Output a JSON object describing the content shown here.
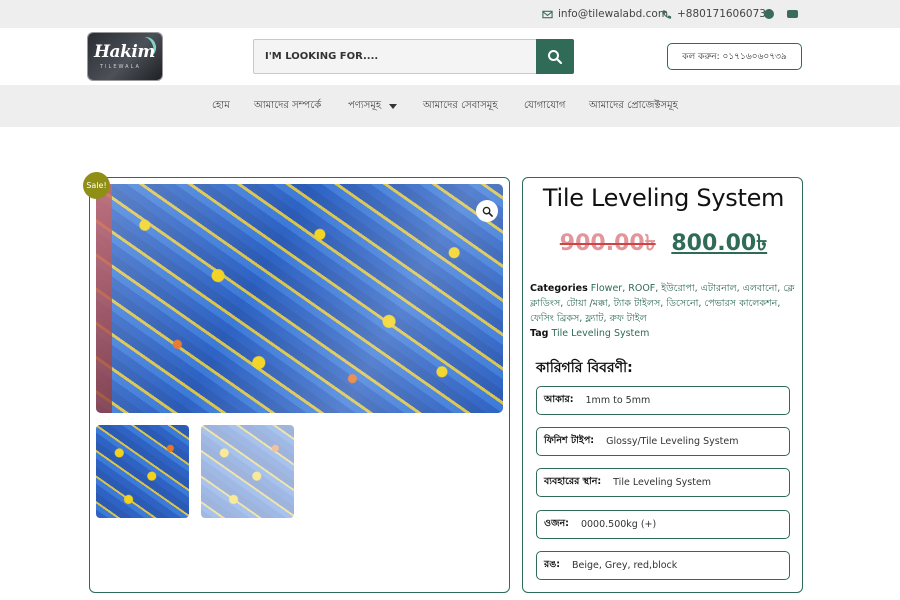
{
  "topbar": {
    "email": "info@tilewalabd.com",
    "phone": "+8801716060739"
  },
  "header": {
    "logo_text": "Hakim",
    "logo_sub": "TILEWALA",
    "search_placeholder": "I'M LOOKING FOR....",
    "call_button": "কল করুন: ০১৭১৬০৬০৭৩৯"
  },
  "nav": {
    "items": [
      "হোম",
      "আমাদের সম্পর্কে",
      "পণ্যসমূহ",
      "আমাদের সেবাসমূহ",
      "যোগাযোগ",
      "আমাদের প্রোজেক্টসমূহ"
    ]
  },
  "gallery": {
    "sale_badge": "Sale!"
  },
  "product": {
    "title": "Tile Leveling System",
    "old_price": "900.00৳",
    "new_price": "800.00৳",
    "categories_label": "Categories",
    "categories": "Flower, ROOF, ইউরোপা, এটারনাল, এলবানো, ক্লে ক্লাডিংস, টোয়া /মক্কা, ট্যাক টাইলস, ডিসেনো, পেভারস কালেকশন, ফেসিং ব্রিকস, ফ্ল্যাট, রুফ টাইল",
    "tag_label": "Tag",
    "tag": "Tile Leveling System",
    "spec_heading": "কারিগরি বিবরণী:",
    "specs": [
      {
        "key": "আকার:",
        "value": "1mm to 5mm"
      },
      {
        "key": "ফিনিশ টাইপ:",
        "value": "Glossy/Tile Leveling System"
      },
      {
        "key": "ব্যবহারের স্থান:",
        "value": "Tile Leveling System"
      },
      {
        "key": "ওজন:",
        "value": "0000.500kg (+)"
      },
      {
        "key": "রঙ:",
        "value": "Beige, Grey, red,block"
      }
    ]
  },
  "colors": {
    "accent": "#2f6b57",
    "topbar_bg": "#eeeeee",
    "sale_badge": "#8f8f16",
    "old_price": "#e2969a"
  },
  "icons": [
    "mail-icon",
    "phone-icon",
    "facebook-icon",
    "youtube-icon",
    "search-icon",
    "zoom-icon",
    "caret-down-icon"
  ]
}
